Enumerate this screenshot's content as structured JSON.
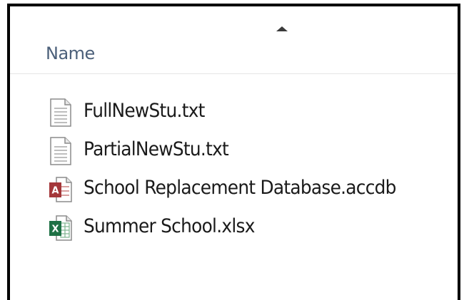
{
  "header": {
    "column_name": "Name",
    "sort": "ascending"
  },
  "files": [
    {
      "name": "FullNewStu.txt",
      "icon": "text-file-icon"
    },
    {
      "name": "PartialNewStu.txt",
      "icon": "text-file-icon"
    },
    {
      "name": "School Replacement Database.accdb",
      "icon": "access-database-icon"
    },
    {
      "name": "Summer School.xlsx",
      "icon": "excel-spreadsheet-icon"
    }
  ],
  "colors": {
    "header_text": "#4c607a",
    "access_red": "#a4373a",
    "excel_green": "#1e7145"
  }
}
